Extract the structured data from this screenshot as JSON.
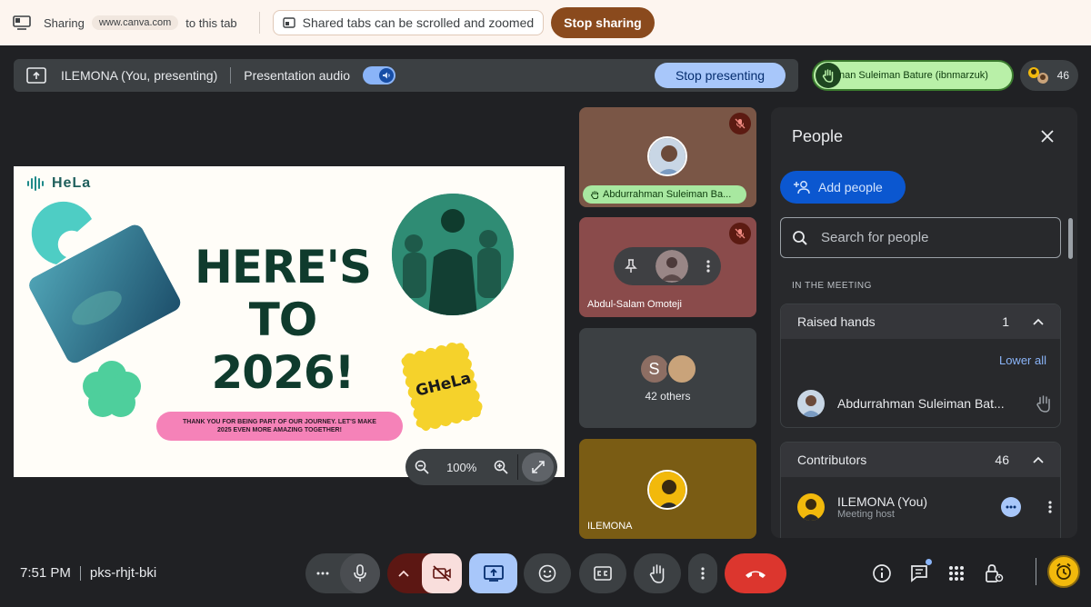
{
  "sharing_bar": {
    "label": "Sharing",
    "domain": "www.canva.com",
    "suffix": "to this tab",
    "tip": "Shared tabs can be scrolled and zoomed",
    "stop_sharing": "Stop sharing"
  },
  "presenting_bar": {
    "presenter": "ILEMONA (You, presenting)",
    "audio_label": "Presentation audio",
    "audio_on": true,
    "stop_presenting": "Stop presenting"
  },
  "speaker_chip": {
    "name": "nan Suleiman Bature (ibnmarzuk)"
  },
  "participants_count": "46",
  "slide": {
    "logo": "HeLa",
    "title_lines": [
      "HERE'S",
      "TO",
      "2026!"
    ],
    "banner": "THANK YOU FOR BEING PART OF OUR JOURNEY. LET'S MAKE 2025 EVEN MORE AMAZING TOGETHER!",
    "badge": "GHeLa",
    "colors": {
      "title": "#0f3b2d",
      "banner": "#f582b8",
      "badge": "#f5d22b",
      "accent": "#4ecdc4"
    }
  },
  "zoom": {
    "level": "100%"
  },
  "tiles": [
    {
      "name": "Abdurrahman Suleiman Ba...",
      "muted": true,
      "hand_raised": true
    },
    {
      "name": "Abdul-Salam Omoteji",
      "muted": true
    },
    {
      "avatar_letter": "S",
      "others": "42 others"
    },
    {
      "name": "ILEMONA"
    }
  ],
  "people_panel": {
    "title": "People",
    "add_people": "Add people",
    "search_placeholder": "Search for people",
    "section": "IN THE MEETING",
    "raised_hands": {
      "label": "Raised hands",
      "count": "1",
      "lower_all": "Lower all",
      "person": "Abdurrahman Suleiman Bat..."
    },
    "contributors": {
      "label": "Contributors",
      "count": "46",
      "person": "ILEMONA (You)",
      "role": "Meeting host"
    }
  },
  "bottom_bar": {
    "time": "7:51 PM",
    "meeting_code": "pks-rhjt-bki"
  }
}
